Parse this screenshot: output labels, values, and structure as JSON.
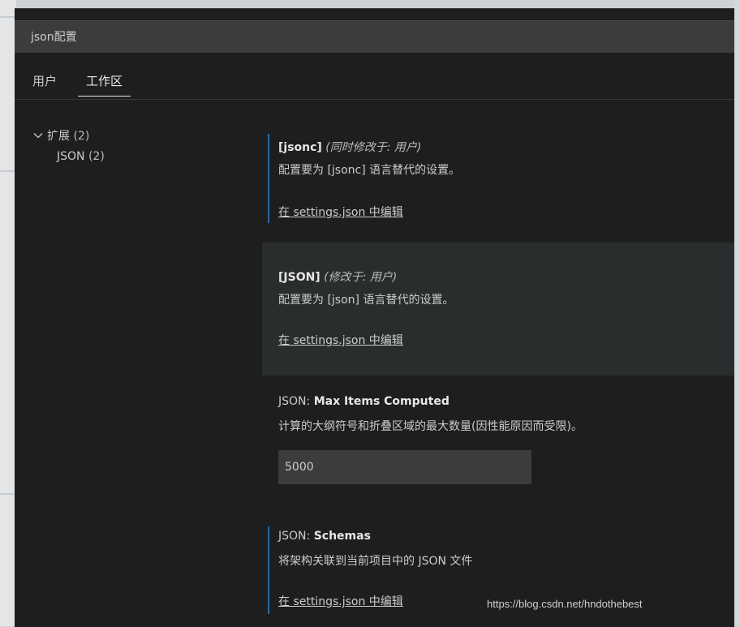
{
  "search": {
    "value": "json配置"
  },
  "tabs": [
    {
      "label": "用户"
    },
    {
      "label": "工作区"
    }
  ],
  "toc": {
    "group_label": "扩展",
    "group_count": "(2)",
    "child_label": "JSON",
    "child_count": "(2)"
  },
  "settings": [
    {
      "key": "[jsonc]",
      "modified": "(同时修改于: 用户)",
      "description": "配置要为 [jsonc] 语言替代的设置。",
      "link": "在 settings.json 中编辑"
    },
    {
      "key": "[JSON]",
      "modified": "(修改于: 用户)",
      "description": "配置要为 [json] 语言替代的设置。",
      "link": "在 settings.json 中编辑"
    },
    {
      "category": "JSON:",
      "name": "Max Items Computed",
      "description": "计算的大纲符号和折叠区域的最大数量(因性能原因而受限)。",
      "value": "5000"
    },
    {
      "category": "JSON:",
      "name": "Schemas",
      "description": "将架构关联到当前项目中的 JSON 文件",
      "link": "在 settings.json 中编辑"
    }
  ],
  "watermark": "https://blog.csdn.net/hndothebest",
  "colors": {
    "accent": "#0e70c0",
    "editor_bg": "#1e1e1e",
    "highlight_bg": "#2a2d2e",
    "input_bg": "#3c3c3c"
  }
}
